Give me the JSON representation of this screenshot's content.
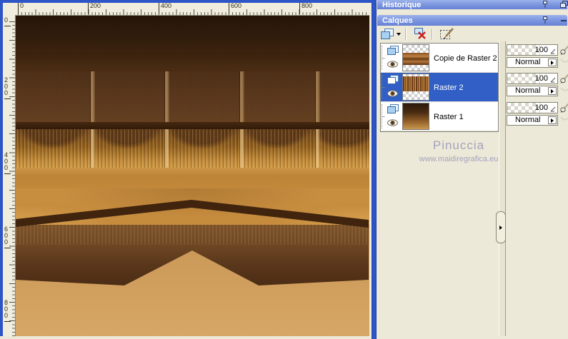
{
  "window": {
    "rulers": {
      "top": [
        {
          "t": "0"
        },
        {
          "t": "200"
        },
        {
          "t": "400"
        },
        {
          "t": "600"
        },
        {
          "t": "800"
        }
      ],
      "left": [
        {
          "t": "0"
        },
        {
          "t": "200"
        },
        {
          "t": "400"
        },
        {
          "t": "600"
        },
        {
          "t": "800"
        }
      ]
    }
  },
  "panels": {
    "historique": {
      "title": "Historique"
    },
    "calques": {
      "title": "Calques"
    }
  },
  "layers": [
    {
      "name": "Copie de Raster 2",
      "opacity": "100",
      "blend": "Normal"
    },
    {
      "name": "Raster 2",
      "opacity": "100",
      "blend": "Normal"
    },
    {
      "name": "Raster 1",
      "opacity": "100",
      "blend": "Normal"
    }
  ],
  "watermark": {
    "line1": "Pinuccia",
    "line2": "www.maidiregrafica.eu"
  },
  "icons": {
    "toolbar": [
      "new-layer-icon",
      "delete-layer-icon",
      "edit-selection-icon"
    ],
    "headers": [
      "pin-icon",
      "restore-icon",
      "collapse-icon"
    ],
    "layer_row": [
      "raster-layer-icon",
      "eye-visibility-icon"
    ],
    "controls": [
      "brush-icon",
      "opacity-slider-corner-icon",
      "dropdown-arrow-icon",
      "splitter-arrow-icon"
    ]
  },
  "colors": {
    "window_border": "#2d55c8",
    "panel_bg": "#ece9d8",
    "header_gradient_top": "#9cb2ea",
    "header_gradient_bottom": "#6581d5",
    "selected_layer_bg": "#315fc6",
    "canvas_dark_brown": "#2f1c0c",
    "canvas_mid_brown": "#5d3a1f",
    "canvas_gold": "#c08a3a",
    "canvas_tan": "#d2a05e",
    "watermark_text": "#a6a2be"
  }
}
